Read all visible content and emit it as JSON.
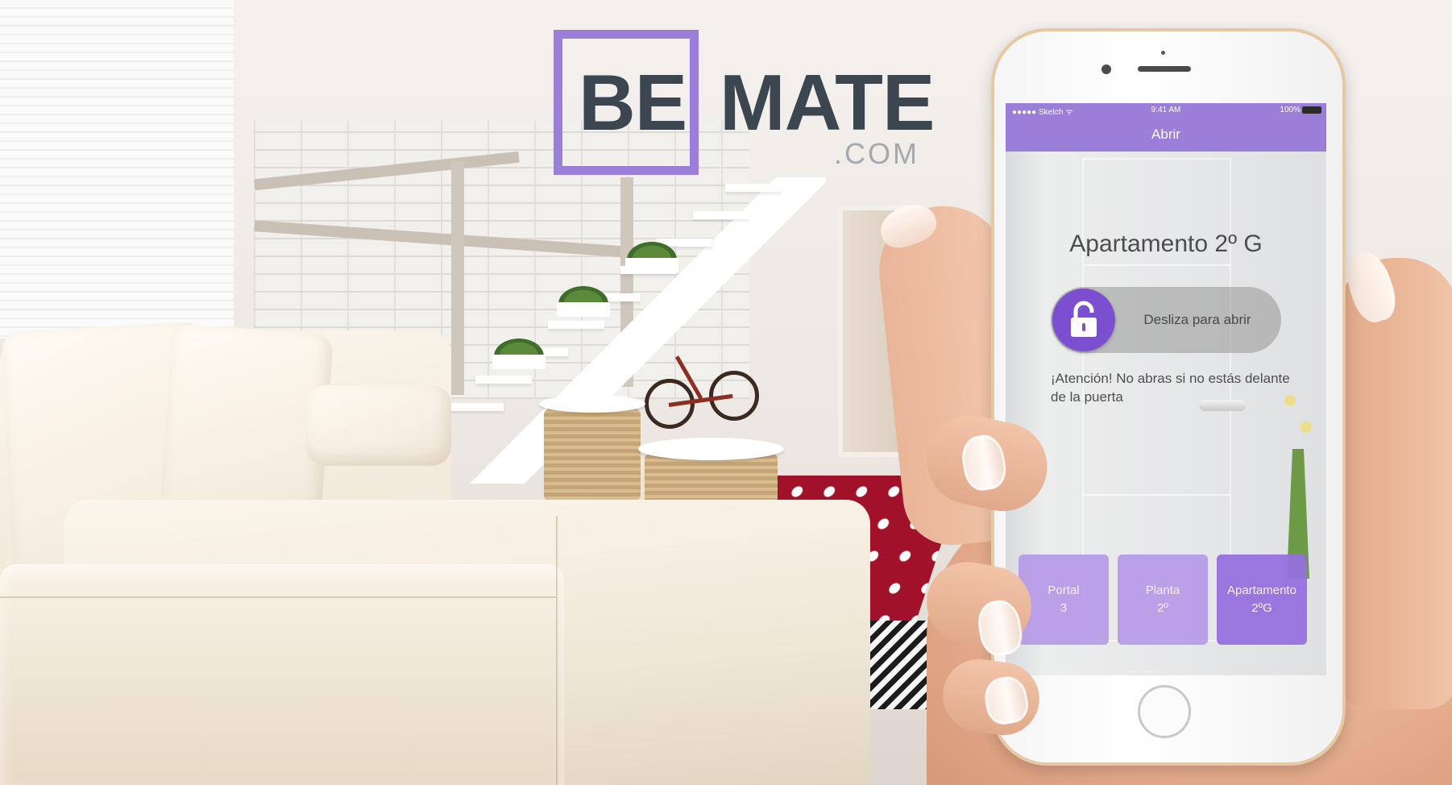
{
  "logo": {
    "be": "BE",
    "mate": "MATE",
    "com": ".COM",
    "accent_color": "#9b7ed8",
    "text_color": "#3b4650"
  },
  "phone": {
    "status_bar": {
      "carrier": "●●●●● Sketch ᯤ",
      "time": "9:41 AM",
      "battery": "100%"
    },
    "nav_title": "Abrir",
    "apartment_title": "Apartamento 2º G",
    "slider": {
      "label": "Desliza para abrir",
      "icon": "padlock-icon"
    },
    "warning_text": "¡Atención! No abras si no estás delante de la puerta",
    "tiles": [
      {
        "line1": "Portal",
        "line2": "3"
      },
      {
        "line1": "Planta",
        "line2": "2º"
      },
      {
        "line1": "Apartamento",
        "line2": "2ºG"
      }
    ],
    "accent_color": "#9b7ed8",
    "knob_color": "#7b4fcf"
  }
}
